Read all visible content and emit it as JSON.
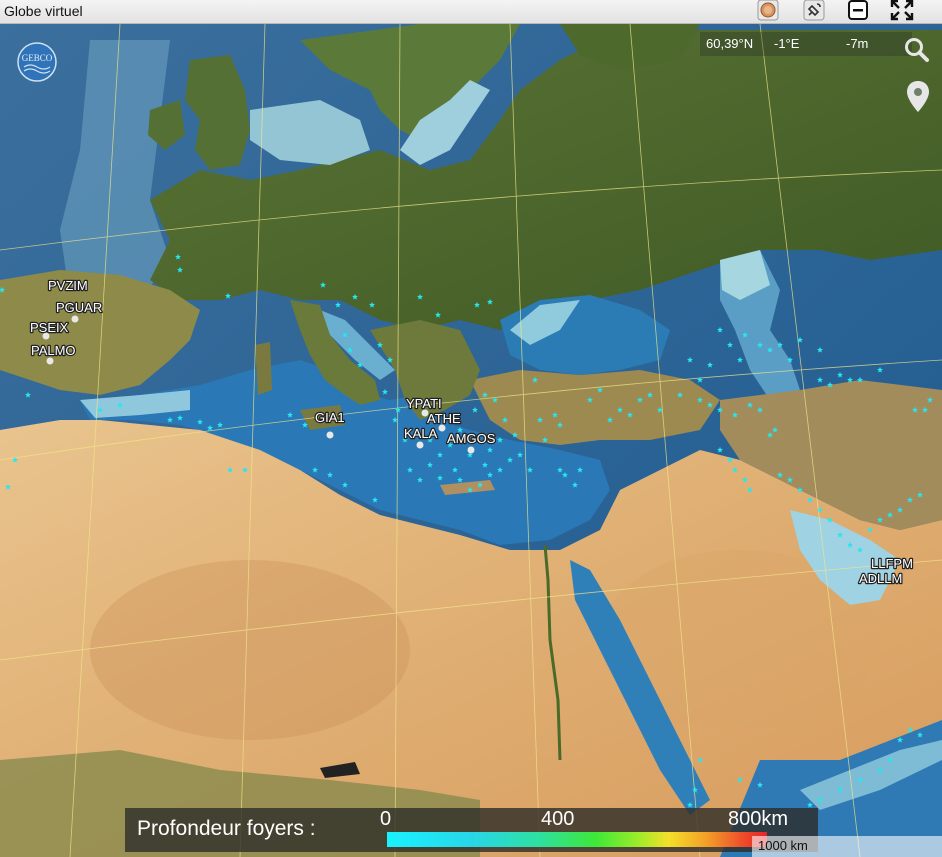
{
  "window": {
    "title": "Globe virtuel",
    "buttons": [
      {
        "name": "layers-button",
        "icon": "globe-circle-icon"
      },
      {
        "name": "satellite-button",
        "icon": "satellite-icon"
      },
      {
        "name": "minimize-button",
        "icon": "minus-box-icon"
      },
      {
        "name": "fullscreen-button",
        "icon": "expand-arrows-icon"
      }
    ]
  },
  "logo": {
    "text": "GEBCO"
  },
  "coordinates": {
    "lat": "60,39°N",
    "lon": "-1°E",
    "depth": "-7m"
  },
  "tools": {
    "search_icon": "search-icon",
    "marker_icon": "location-pin-icon"
  },
  "stations": [
    {
      "id": "PVZIM",
      "label": "PVZIM"
    },
    {
      "id": "PGUAR",
      "label": "PGUAR"
    },
    {
      "id": "PSEIX",
      "label": "PSEIX"
    },
    {
      "id": "PALMO",
      "label": "PALMO"
    },
    {
      "id": "GIA1",
      "label": "GIA1"
    },
    {
      "id": "YPATI",
      "label": "YPATI"
    },
    {
      "id": "ATHE",
      "label": "ATHE"
    },
    {
      "id": "KALA",
      "label": "KALA"
    },
    {
      "id": "AMGOS",
      "label": "AMGOS"
    },
    {
      "id": "LLFPM",
      "label": "LLFPM"
    },
    {
      "id": "ADLLM",
      "label": "ADLLM"
    }
  ],
  "legend": {
    "title": "Profondeur foyers :",
    "ticks": [
      "0",
      "400",
      "800km"
    ],
    "colors": {
      "min": "#19f3ff",
      "mid": "#3ee838",
      "max": "#e8222a"
    }
  },
  "scale_bar": {
    "label": "1000 km"
  },
  "colors": {
    "epicenter": "#27e6ee",
    "station": "#e8e8e8",
    "deep_water": "#1f5f96",
    "shallow_water": "#9fcfdc",
    "land_green": "#4f6a2a",
    "desert": "#e2b47a"
  }
}
